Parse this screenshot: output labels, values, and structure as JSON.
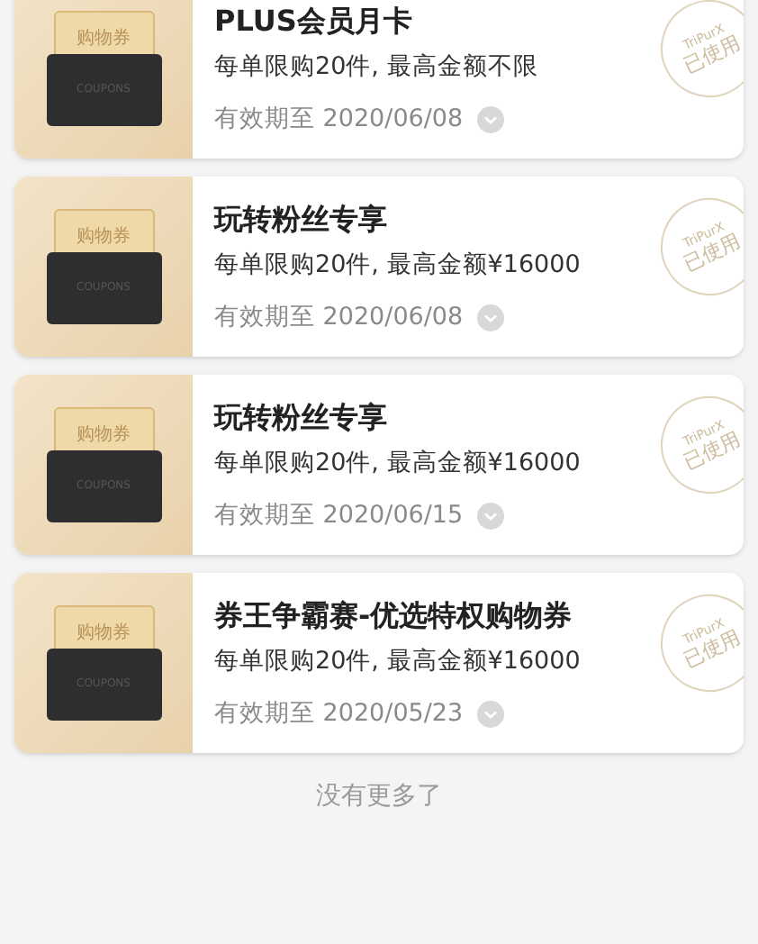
{
  "coupons": [
    {
      "title": "PLUS会员月卡",
      "limit": "每单限购20件, 最高金额不限",
      "validity": "有效期至 2020/06/08",
      "ticket_label": "购物券",
      "wallet_label": "COUPONS",
      "used": true,
      "stamp_ring": "TriPurX",
      "stamp_text": "已使用"
    },
    {
      "title": "玩转粉丝专享",
      "limit": "每单限购20件, 最高金额¥16000",
      "validity": "有效期至 2020/06/08",
      "ticket_label": "购物券",
      "wallet_label": "COUPONS",
      "used": true,
      "stamp_ring": "TriPurX",
      "stamp_text": "已使用"
    },
    {
      "title": "玩转粉丝专享",
      "limit": "每单限购20件, 最高金额¥16000",
      "validity": "有效期至 2020/06/15",
      "ticket_label": "购物券",
      "wallet_label": "COUPONS",
      "used": true,
      "stamp_ring": "TriPurX",
      "stamp_text": "已使用"
    },
    {
      "title": "券王争霸赛-优选特权购物券",
      "limit": "每单限购20件, 最高金额¥16000",
      "validity": "有效期至 2020/05/23",
      "ticket_label": "购物券",
      "wallet_label": "COUPONS",
      "used": true,
      "stamp_ring": "TriPurX",
      "stamp_text": "已使用"
    }
  ],
  "end_note": "没有更多了"
}
